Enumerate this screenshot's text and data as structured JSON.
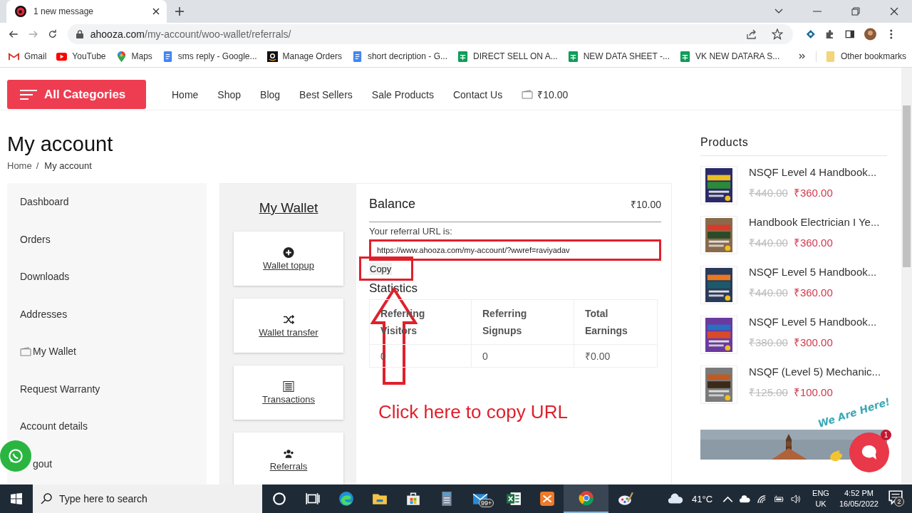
{
  "browser": {
    "tab": {
      "title": "1 new message"
    },
    "address": {
      "domain": "ahooza.com",
      "path": "/my-account/woo-wallet/referrals/"
    },
    "bookmarks": [
      {
        "label": "Gmail",
        "kind": "gmail"
      },
      {
        "label": "YouTube",
        "kind": "youtube"
      },
      {
        "label": "Maps",
        "kind": "maps"
      },
      {
        "label": "sms reply - Google...",
        "kind": "docs"
      },
      {
        "label": "Manage Orders",
        "kind": "amazon"
      },
      {
        "label": "short decription - G...",
        "kind": "docs"
      },
      {
        "label": "DIRECT SELL ON A...",
        "kind": "sheets"
      },
      {
        "label": "NEW DATA SHEET -...",
        "kind": "sheets"
      },
      {
        "label": "VK NEW DATARA S...",
        "kind": "sheets"
      }
    ],
    "other_bookmarks": "Other bookmarks"
  },
  "header": {
    "categories_button": "All Categories",
    "nav": [
      "Home",
      "Shop",
      "Blog",
      "Best Sellers",
      "Sale Products",
      "Contact Us"
    ],
    "cart_total": "₹10.00"
  },
  "page_title": "My account",
  "breadcrumb": {
    "items": [
      "Home",
      "My account"
    ],
    "separator": "/"
  },
  "account_nav": [
    {
      "label": "Dashboard",
      "kind": "text"
    },
    {
      "label": "Orders",
      "kind": "text"
    },
    {
      "label": "Downloads",
      "kind": "text"
    },
    {
      "label": "Addresses",
      "kind": "text"
    },
    {
      "label": "My Wallet",
      "kind": "wallet"
    },
    {
      "label": "Request Warranty",
      "kind": "text"
    },
    {
      "label": "Account details",
      "kind": "text"
    },
    {
      "label": "gout",
      "kind": "covered"
    }
  ],
  "wallet": {
    "title": "My Wallet",
    "actions": [
      {
        "label": "Wallet topup",
        "kind": "topup"
      },
      {
        "label": "Wallet transfer",
        "kind": "transfer"
      },
      {
        "label": "Transactions",
        "kind": "transactions"
      },
      {
        "label": "Referrals",
        "kind": "referrals"
      }
    ],
    "balance_label": "Balance",
    "balance": "₹10.00",
    "referral_label": "Your referral URL is:",
    "referral_url": "https://www.ahooza.com/my-account/?wwref=raviyadav",
    "copy_button": "Copy",
    "statistics_title": "Statistics",
    "table": {
      "columns": [
        "Referring Visitors",
        "Referring Signups",
        "Total Earnings"
      ],
      "rows": [
        [
          "0",
          "0",
          "₹0.00"
        ]
      ]
    }
  },
  "annotation": {
    "text": "Click here to copy URL"
  },
  "products": {
    "title": "Products",
    "items": [
      {
        "name": "NSQF Level 4 Handbook...",
        "old_price": "₹440.00",
        "price": "₹360.00"
      },
      {
        "name": "Handbook Electrician I Ye...",
        "old_price": "₹440.00",
        "price": "₹360.00"
      },
      {
        "name": "NSQF Level 5 Handbook...",
        "old_price": "₹440.00",
        "price": "₹360.00"
      },
      {
        "name": "NSQF Level 5 Handbook...",
        "old_price": "₹380.00",
        "price": "₹300.00"
      },
      {
        "name": "NSQF (Level 5) Mechanic...",
        "old_price": "₹125.00",
        "price": "₹100.00"
      }
    ]
  },
  "chat_widget": {
    "text": "We Are Here!",
    "badge": "1"
  },
  "taskbar": {
    "search_placeholder": "Type here to search",
    "mail_badge": "99+",
    "temperature": "41°C",
    "language": [
      "ENG",
      "UK"
    ],
    "time": "4:52 PM",
    "date": "16/05/2022",
    "notifications": "2"
  }
}
